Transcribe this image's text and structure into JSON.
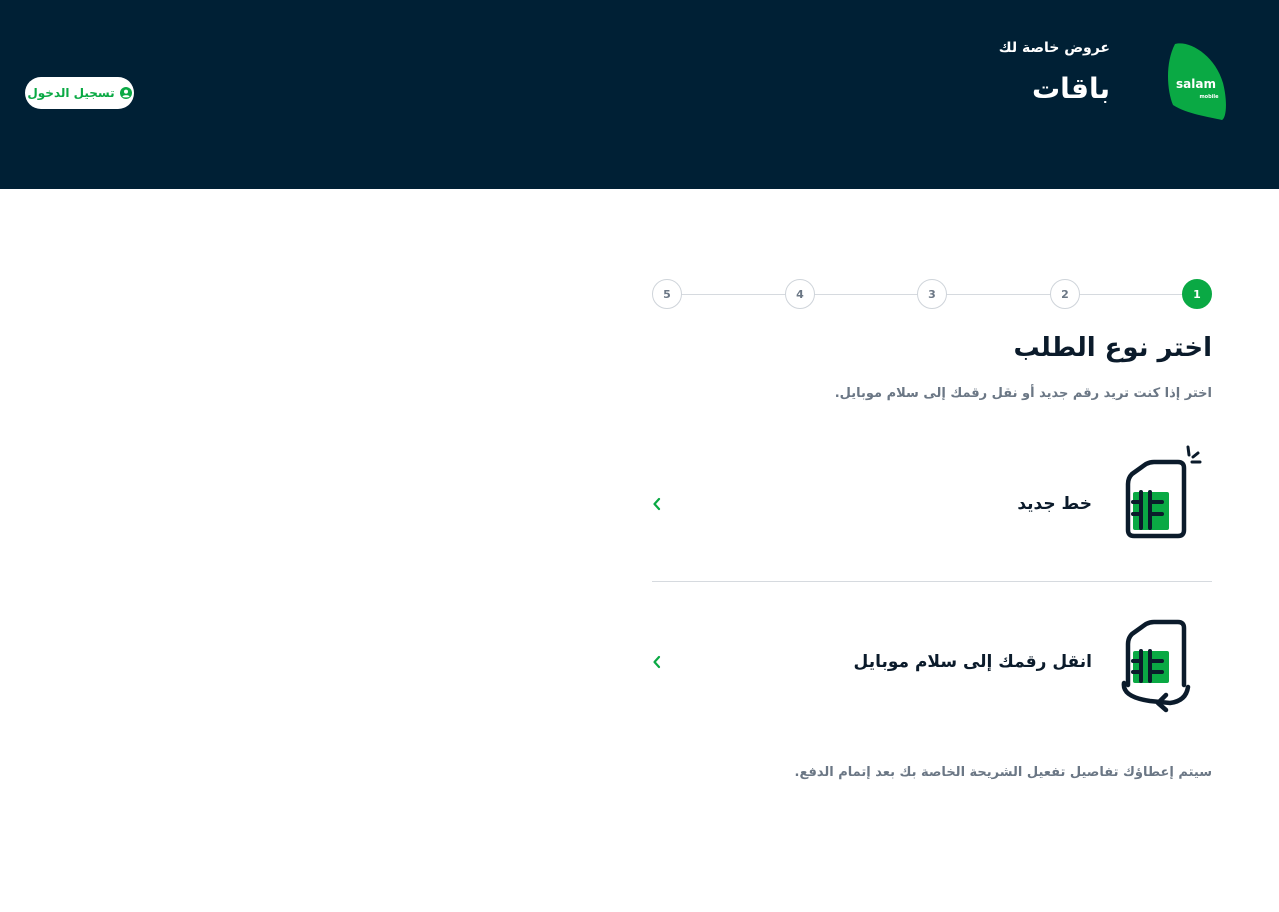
{
  "header": {
    "login_label": "تسجيل الدخول",
    "subtitle": "عروض خاصة لك",
    "title": "باقات",
    "logo_text": "salam",
    "logo_subtext": "mobile",
    "background_color": "#002035"
  },
  "stepper": {
    "steps": [
      "1",
      "2",
      "3",
      "4",
      "5"
    ],
    "active_step": 1,
    "accent_color": "#0aa944"
  },
  "main": {
    "title": "اختر نوع الطلب",
    "description": "اختر إذا كنت تريد رقم جديد أو نقل رقمك إلى سلام موبايل.",
    "options": [
      {
        "label": "خط جديد",
        "icon": "new-sim-icon"
      },
      {
        "label": "انقل رقمك إلى سلام موبايل",
        "icon": "transfer-sim-icon"
      }
    ],
    "footer_note": "سيتم إعطاؤك تفاصيل تفعيل الشريحة الخاصة بك بعد إتمام الدفع."
  }
}
